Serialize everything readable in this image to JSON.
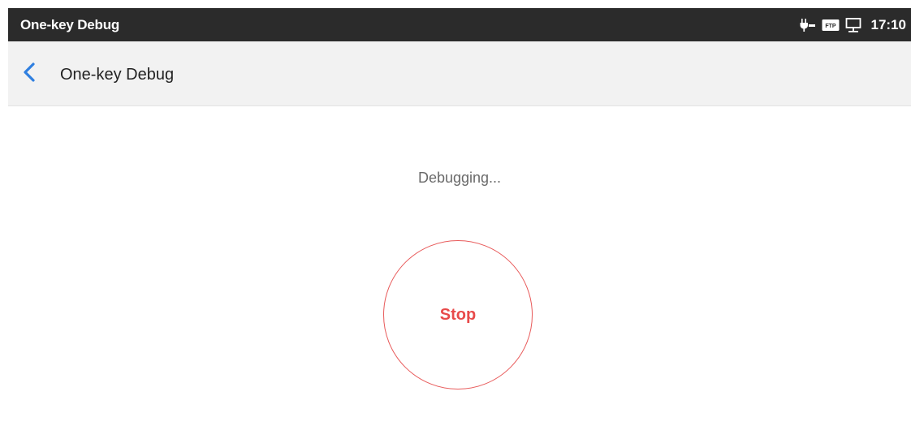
{
  "status_bar": {
    "title": "One-key Debug",
    "time": "17:10",
    "icons": [
      "poe-power-icon",
      "ftp-icon",
      "network-icon"
    ],
    "ftp_label": "FTP"
  },
  "app_bar": {
    "title": "One-key Debug",
    "back_icon": "chevron-left-icon"
  },
  "main": {
    "status_text": "Debugging...",
    "stop_label": "Stop"
  },
  "colors": {
    "status_bar_bg": "#2b2b2b",
    "app_bar_bg": "#f2f2f2",
    "accent_blue": "#2f7fe0",
    "stop_red": "#e84a4a"
  }
}
